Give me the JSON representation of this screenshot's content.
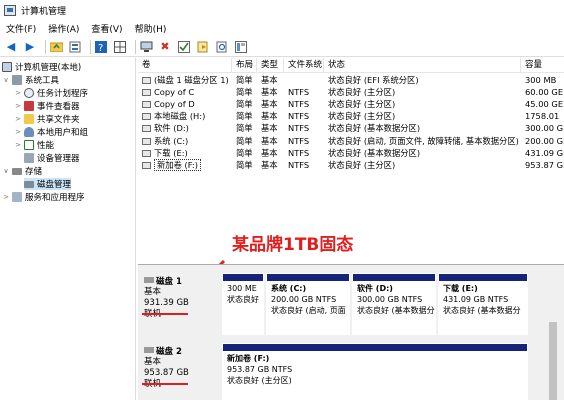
{
  "title": "计算机管理",
  "menus": [
    "文件(F)",
    "操作(A)",
    "查看(V)",
    "帮助(H)"
  ],
  "toolbar_icons": [
    "back-icon",
    "forward-icon",
    "folder-up-icon",
    "properties-icon",
    "help-icon",
    "grid-icon",
    "connect-icon",
    "delete-icon",
    "checklist-icon",
    "open-icon",
    "search-icon",
    "layout-icon"
  ],
  "tree": [
    {
      "label": "计算机管理(本地)",
      "icon": "computer-icon"
    },
    {
      "label": "系统工具",
      "icon": "tools-icon"
    },
    {
      "label": "任务计划程序",
      "icon": "clock-icon"
    },
    {
      "label": "事件查看器",
      "icon": "event-icon"
    },
    {
      "label": "共享文件夹",
      "icon": "folder-icon"
    },
    {
      "label": "本地用户和组",
      "icon": "users-icon"
    },
    {
      "label": "性能",
      "icon": "performance-icon"
    },
    {
      "label": "设备管理器",
      "icon": "device-icon"
    },
    {
      "label": "存储",
      "icon": "storage-icon"
    },
    {
      "label": "磁盘管理",
      "icon": "disk-icon"
    },
    {
      "label": "服务和应用程序",
      "icon": "services-icon"
    }
  ],
  "table": {
    "headers": [
      "卷",
      "布局",
      "类型",
      "文件系统",
      "状态",
      "容量"
    ],
    "rows": [
      [
        "(磁盘 1 磁盘分区 1)",
        "简单",
        "基本",
        "",
        "状态良好 (EFI 系统分区)",
        "300 MB"
      ],
      [
        "Copy of C",
        "简单",
        "基本",
        "NTFS",
        "状态良好 (主分区)",
        "60.00 GE"
      ],
      [
        "Copy of D",
        "简单",
        "基本",
        "NTFS",
        "状态良好 (主分区)",
        "45.00 GE"
      ],
      [
        "本地磁盘 (H:)",
        "简单",
        "基本",
        "NTFS",
        "状态良好 (主分区)",
        "1758.01"
      ],
      [
        "软件 (D:)",
        "简单",
        "基本",
        "NTFS",
        "状态良好 (基本数据分区)",
        "300.00 GE"
      ],
      [
        "系统 (C:)",
        "简单",
        "基本",
        "NTFS",
        "状态良好 (启动, 页面文件, 故障转储, 基本数据分区)",
        "200.00 GE"
      ],
      [
        "下载 (E:)",
        "简单",
        "基本",
        "NTFS",
        "状态良好 (基本数据分区)",
        "431.09 GE"
      ],
      [
        "新加卷 (F:)",
        "简单",
        "基本",
        "NTFS",
        "状态良好 (主分区)",
        "953.87 GE"
      ]
    ]
  },
  "annotation": "某品牌1TB固态",
  "disks": [
    {
      "name": "磁盘 1",
      "type": "基本",
      "size": "931.39 GB",
      "status": "联机",
      "partitions": [
        {
          "name": "",
          "line1": "300 ME",
          "line2": "状态良好"
        },
        {
          "name": "系统 (C:)",
          "line1": "200.00 GB NTFS",
          "line2": "状态良好 (启动, 页面"
        },
        {
          "name": "软件 (D:)",
          "line1": "300.00 GB NTFS",
          "line2": "状态良好 (基本数据分"
        },
        {
          "name": "下载 (E:)",
          "line1": "431.09 GB NTFS",
          "line2": "状态良好 (基本数据分"
        }
      ]
    },
    {
      "name": "磁盘 2",
      "type": "基本",
      "size": "953.87 GB",
      "status": "联机",
      "partitions": [
        {
          "name": "新加卷 (F:)",
          "line1": "953.87 GB NTFS",
          "line2": "状态良好 (主分区)"
        }
      ]
    }
  ],
  "colors": {
    "accent_red": "#e21d1d",
    "partition_bar": "#15237a",
    "selection": "#cce4f7"
  }
}
